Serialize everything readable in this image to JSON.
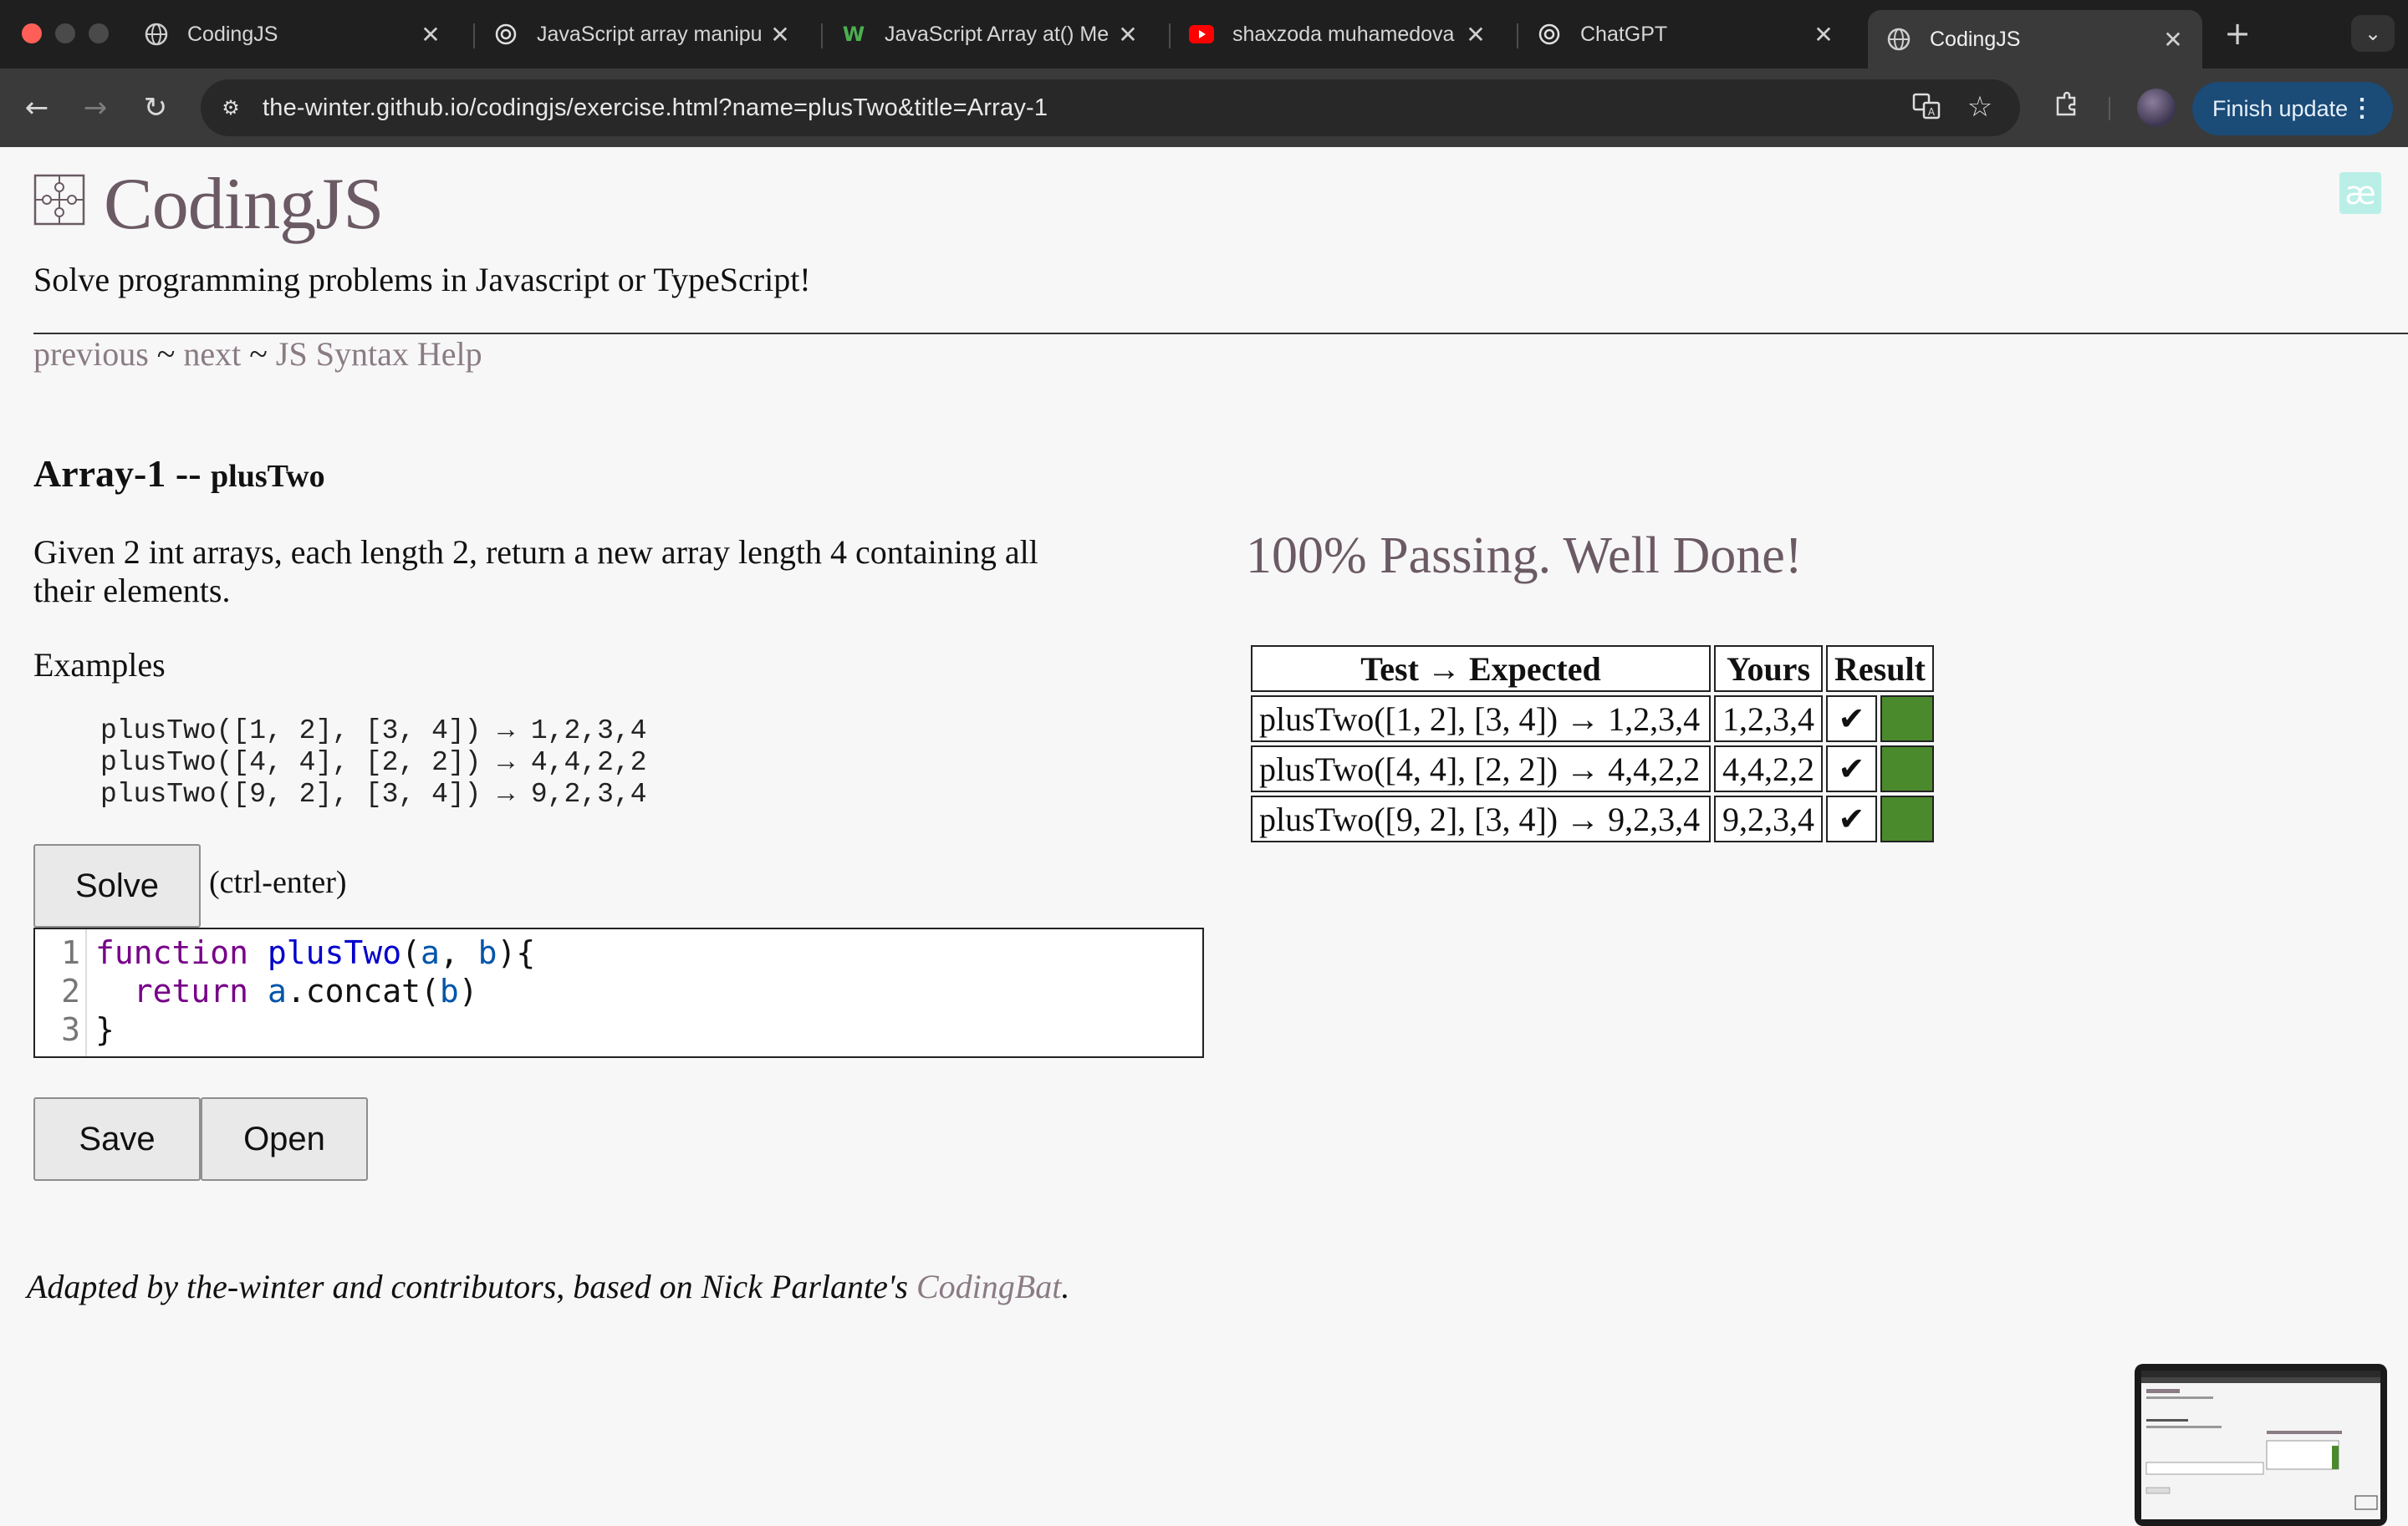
{
  "browser": {
    "tabs": [
      {
        "title": "CodingJS",
        "icon": "globe-icon",
        "active": false
      },
      {
        "title": "JavaScript array manipu",
        "icon": "chatgpt-icon",
        "active": false
      },
      {
        "title": "JavaScript Array at() Me",
        "icon": "w3schools-icon",
        "active": false
      },
      {
        "title": "shaxzoda muhamedova",
        "icon": "youtube-icon",
        "active": false
      },
      {
        "title": "ChatGPT",
        "icon": "chatgpt-icon",
        "active": false
      },
      {
        "title": "CodingJS",
        "icon": "globe-icon",
        "active": true
      }
    ],
    "close_glyph": "✕",
    "new_tab_glyph": "+",
    "url": "the-winter.github.io/codingjs/exercise.html?name=plusTwo&title=Array-1",
    "finish_update_label": "Finish update",
    "colors": {
      "tabbar": "#1f1f1f",
      "toolbar": "#3a3a3a",
      "finish_update": "#1b4b77"
    }
  },
  "site": {
    "title": "CodingJS",
    "tagline": "Solve programming problems in Javascript or TypeScript!",
    "badge": "æ",
    "nav": {
      "previous": "previous",
      "sep1": " ~ ",
      "next": "next",
      "sep2": " ~ ",
      "help": "JS Syntax Help"
    }
  },
  "problem": {
    "category": "Array-1 -- ",
    "name": "plusTwo",
    "description": "Given 2 int arrays, each length 2, return a new array length 4 containing all their elements.",
    "examples_label": "Examples",
    "examples": [
      "plusTwo([1, 2], [3, 4]) → 1,2,3,4",
      "plusTwo([4, 4], [2, 2]) → 4,4,2,2",
      "plusTwo([9, 2], [3, 4]) → 9,2,3,4"
    ]
  },
  "editor": {
    "solve_label": "Solve",
    "hint": "(ctrl-enter)",
    "line_numbers": [
      "1",
      "2",
      "3"
    ],
    "code": {
      "l1_kw": "function",
      "l1_fn": "plusTwo",
      "l1_open": "(",
      "l1_a": "a",
      "l1_comma": ", ",
      "l1_b": "b",
      "l1_close": "){",
      "l2_indent": "  ",
      "l2_kw": "return",
      "l2_sp": " ",
      "l2_a": "a",
      "l2_method": ".concat(",
      "l2_b": "b",
      "l2_end": ")",
      "l3": "}"
    },
    "save_label": "Save",
    "open_label": "Open"
  },
  "results": {
    "status": "100% Passing. Well Done!",
    "headers": [
      "Test → Expected",
      "Yours",
      "Result"
    ],
    "rows": [
      {
        "test": "plusTwo([1, 2], [3, 4]) → 1,2,3,4",
        "yours": "1,2,3,4",
        "check": "✔"
      },
      {
        "test": "plusTwo([4, 4], [2, 2]) → 4,4,2,2",
        "yours": "4,4,2,2",
        "check": "✔"
      },
      {
        "test": "plusTwo([9, 2], [3, 4]) → 9,2,3,4",
        "yours": "9,2,3,4",
        "check": "✔"
      }
    ],
    "pass_color": "#4b8a2c"
  },
  "footer": {
    "text": "Adapted by the-winter and contributors, based on Nick Parlante's ",
    "link": "CodingBat",
    "end": "."
  }
}
